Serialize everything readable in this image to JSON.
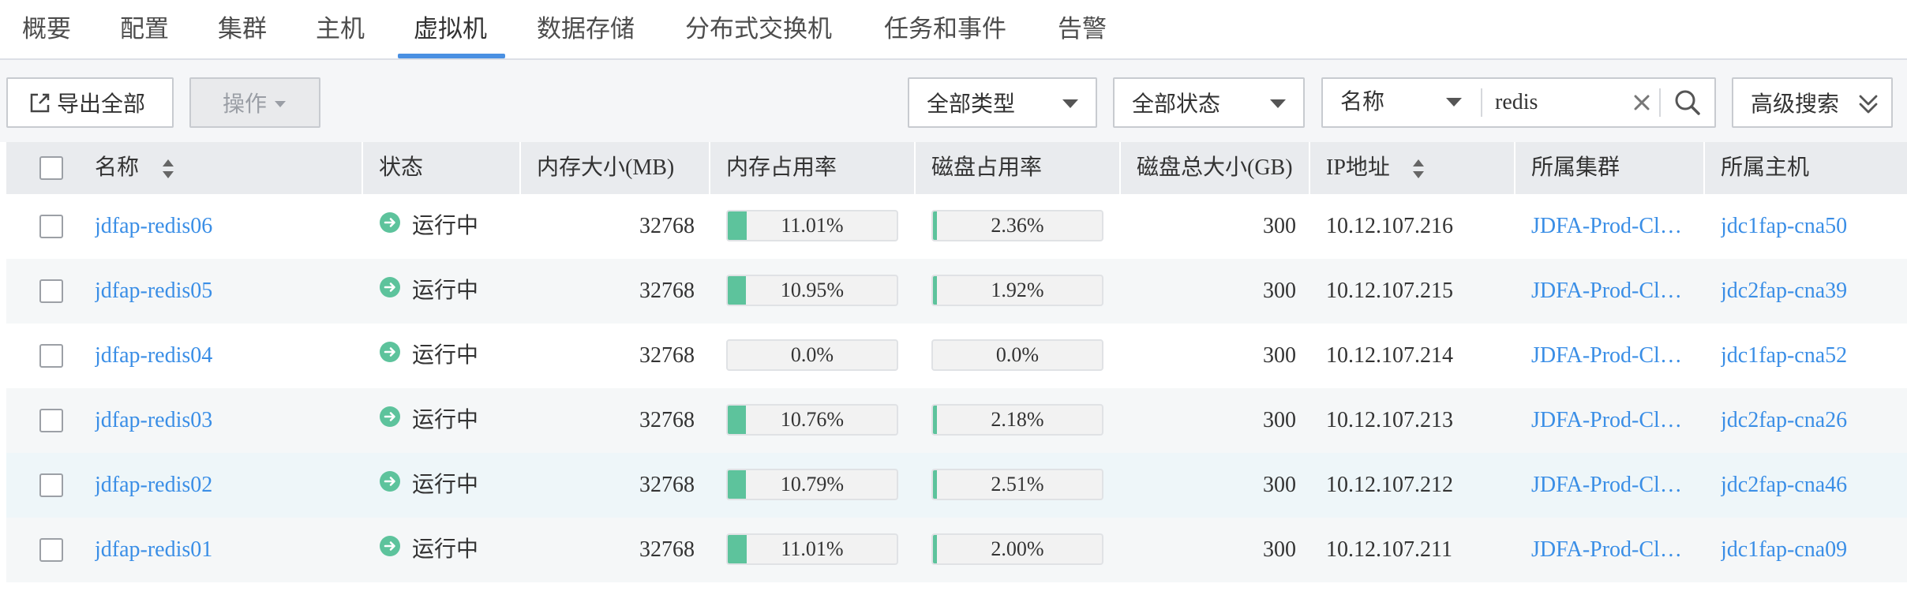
{
  "tabs": [
    {
      "label": "概要"
    },
    {
      "label": "配置"
    },
    {
      "label": "集群"
    },
    {
      "label": "主机"
    },
    {
      "label": "虚拟机",
      "active": true
    },
    {
      "label": "数据存储"
    },
    {
      "label": "分布式交换机"
    },
    {
      "label": "任务和事件"
    },
    {
      "label": "告警"
    }
  ],
  "toolbar": {
    "export_label": "导出全部",
    "ops_label": "操作",
    "type_select": "全部类型",
    "status_select": "全部状态",
    "search_field": "名称",
    "search_value": "redis",
    "advanced_label": "高级搜索"
  },
  "table": {
    "columns": [
      "名称",
      "状态",
      "内存大小(MB)",
      "内存占用率",
      "磁盘占用率",
      "磁盘总大小(GB)",
      "IP地址",
      "所属集群",
      "所属主机"
    ],
    "rows": [
      {
        "name": "jdfap-redis06",
        "status": "运行中",
        "memory": "32768",
        "mem_usage": "11.01%",
        "mem_pct": 11.01,
        "disk_usage": "2.36%",
        "disk_pct": 2.36,
        "disk_size": "300",
        "ip": "10.12.107.216",
        "cluster": "JDFA-Prod-Cl…",
        "host": "jdc1fap-cna50"
      },
      {
        "name": "jdfap-redis05",
        "status": "运行中",
        "memory": "32768",
        "mem_usage": "10.95%",
        "mem_pct": 10.95,
        "disk_usage": "1.92%",
        "disk_pct": 1.92,
        "disk_size": "300",
        "ip": "10.12.107.215",
        "cluster": "JDFA-Prod-Cl…",
        "host": "jdc2fap-cna39"
      },
      {
        "name": "jdfap-redis04",
        "status": "运行中",
        "memory": "32768",
        "mem_usage": "0.0%",
        "mem_pct": 0,
        "disk_usage": "0.0%",
        "disk_pct": 0,
        "disk_size": "300",
        "ip": "10.12.107.214",
        "cluster": "JDFA-Prod-Cl…",
        "host": "jdc1fap-cna52"
      },
      {
        "name": "jdfap-redis03",
        "status": "运行中",
        "memory": "32768",
        "mem_usage": "10.76%",
        "mem_pct": 10.76,
        "disk_usage": "2.18%",
        "disk_pct": 2.18,
        "disk_size": "300",
        "ip": "10.12.107.213",
        "cluster": "JDFA-Prod-Cl…",
        "host": "jdc2fap-cna26"
      },
      {
        "name": "jdfap-redis02",
        "status": "运行中",
        "memory": "32768",
        "mem_usage": "10.79%",
        "mem_pct": 10.79,
        "disk_usage": "2.51%",
        "disk_pct": 2.51,
        "disk_size": "300",
        "ip": "10.12.107.212",
        "cluster": "JDFA-Prod-Cl…",
        "host": "jdc2fap-cna46"
      },
      {
        "name": "jdfap-redis01",
        "status": "运行中",
        "memory": "32768",
        "mem_usage": "11.01%",
        "mem_pct": 11.01,
        "disk_usage": "2.00%",
        "disk_pct": 2.0,
        "disk_size": "300",
        "ip": "10.12.107.211",
        "cluster": "JDFA-Prod-Cl…",
        "host": "jdc1fap-cna09"
      }
    ]
  },
  "colors": {
    "accent": "#4a90e2",
    "link": "#3a8ee6",
    "status_running": "#5dc39c",
    "usage_bar": "#5dc39c"
  },
  "icons": {
    "export": "export-icon",
    "sort": "sort-icon",
    "status": "running-status-icon",
    "clear": "close-icon",
    "search": "search-icon",
    "advanced": "double-chevron-down-icon"
  }
}
